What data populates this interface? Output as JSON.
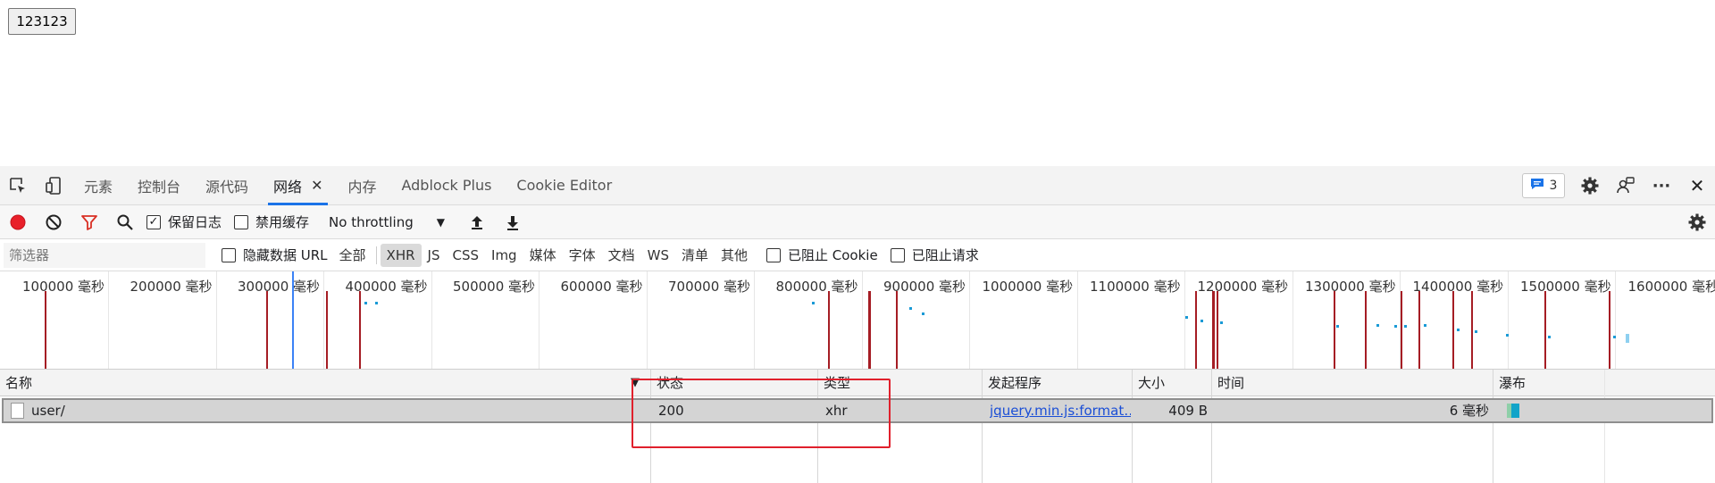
{
  "page": {
    "button_label": "123123"
  },
  "devtools": {
    "tabs": [
      {
        "label": "元素"
      },
      {
        "label": "控制台"
      },
      {
        "label": "源代码"
      },
      {
        "label": "网络",
        "active": true
      },
      {
        "label": "内存"
      },
      {
        "label": "Adblock Plus"
      },
      {
        "label": "Cookie Editor"
      }
    ],
    "close_tab_glyph": "✕",
    "issues_count": "3",
    "more_glyph": "···",
    "close_glyph": "✕",
    "toolbar": {
      "preserve_log": {
        "label": "保留日志",
        "checked": true
      },
      "disable_cache": {
        "label": "禁用缓存",
        "checked": false
      },
      "throttling": "No throttling"
    },
    "filter": {
      "placeholder": "筛选器",
      "hide_data_urls": {
        "label": "隐藏数据 URL",
        "checked": false
      },
      "types": [
        "全部",
        "XHR",
        "JS",
        "CSS",
        "Img",
        "媒体",
        "字体",
        "文档",
        "WS",
        "清单",
        "其他"
      ],
      "selected_type": "XHR",
      "blocked_cookies": {
        "label": "已阻止 Cookie",
        "checked": false
      },
      "blocked_requests": {
        "label": "已阻止请求",
        "checked": false
      }
    },
    "overview": {
      "tick_labels": [
        "100000 毫秒",
        "200000 毫秒",
        "300000 毫秒",
        "400000 毫秒",
        "500000 毫秒",
        "600000 毫秒",
        "700000 毫秒",
        "800000 毫秒",
        "900000 毫秒",
        "1000000 毫秒",
        "1100000 毫秒",
        "1200000 毫秒",
        "1300000 毫秒",
        "1400000 毫秒",
        "1500000 毫秒",
        "1600000 毫秒"
      ]
    },
    "table": {
      "columns": {
        "name": "名称",
        "sort_glyph": "▼",
        "status": "状态",
        "type": "类型",
        "initiator": "发起程序",
        "size": "大小",
        "time": "时间",
        "waterfall": "瀑布"
      },
      "rows": [
        {
          "name": "user/",
          "status": "200",
          "type": "xhr",
          "initiator": "jquery.min.js:format…",
          "size": "409 B",
          "time": "6 毫秒"
        }
      ]
    },
    "colors": {
      "accent": "#1a73e8",
      "record": "#e8202a",
      "filter_icon": "#d93025",
      "highlight_box": "#e0202c",
      "dom_content_loaded": "#3b82f6",
      "load_marker": "#a51d24"
    }
  }
}
